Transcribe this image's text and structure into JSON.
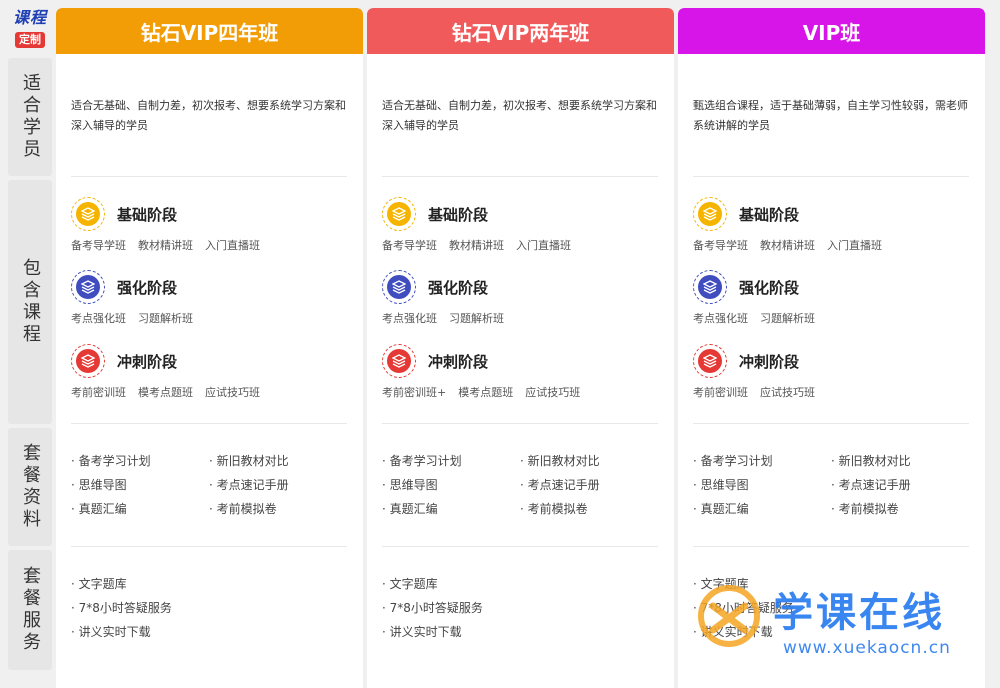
{
  "logo": {
    "top": "课程",
    "badge": "定制"
  },
  "rail": {
    "suitable": "适合学员",
    "courses": "包含课程",
    "materials": "套餐资料",
    "services": "套餐服务"
  },
  "colors": {
    "col1": "#f29c06",
    "col2": "#f15a5a",
    "col3": "#d815e8",
    "basic": "#f5b400",
    "strengthen": "#3f4dbf",
    "sprint": "#e53935"
  },
  "icons": {
    "stage": "layers-icon",
    "watermark": "xuekao-logo-icon"
  },
  "columns": [
    {
      "title": "钻石VIP四年班",
      "desc": "适合无基础、自制力差，初次报考、想要系统学习方案和深入辅导的学员",
      "stages": [
        {
          "title": "基础阶段",
          "items": [
            "备考导学班",
            "教材精讲班",
            "入门直播班"
          ]
        },
        {
          "title": "强化阶段",
          "items": [
            "考点强化班",
            "习题解析班"
          ]
        },
        {
          "title": "冲刺阶段",
          "items": [
            "考前密训班",
            "模考点题班",
            "应试技巧班"
          ]
        }
      ],
      "materials": [
        "· 备考学习计划",
        "· 新旧教材对比",
        "· 思维导图",
        "· 考点速记手册",
        "· 真题汇编",
        "· 考前模拟卷"
      ],
      "services": [
        "· 文字题库",
        "· 7*8小时答疑服务",
        "· 讲义实时下载"
      ]
    },
    {
      "title": "钻石VIP两年班",
      "desc": "适合无基础、自制力差，初次报考、想要系统学习方案和深入辅导的学员",
      "stages": [
        {
          "title": "基础阶段",
          "items": [
            "备考导学班",
            "教材精讲班",
            "入门直播班"
          ]
        },
        {
          "title": "强化阶段",
          "items": [
            "考点强化班",
            "习题解析班"
          ]
        },
        {
          "title": "冲刺阶段",
          "items": [
            "考前密训班+",
            "模考点题班",
            "应试技巧班"
          ]
        }
      ],
      "materials": [
        "· 备考学习计划",
        "· 新旧教材对比",
        "· 思维导图",
        "· 考点速记手册",
        "· 真题汇编",
        "· 考前模拟卷"
      ],
      "services": [
        "· 文字题库",
        "· 7*8小时答疑服务",
        "· 讲义实时下载"
      ]
    },
    {
      "title": "VIP班",
      "desc": "甄选组合课程，适于基础薄弱，自主学习性较弱，需老师系统讲解的学员",
      "stages": [
        {
          "title": "基础阶段",
          "items": [
            "备考导学班",
            "教材精讲班",
            "入门直播班"
          ]
        },
        {
          "title": "强化阶段",
          "items": [
            "考点强化班",
            "习题解析班"
          ]
        },
        {
          "title": "冲刺阶段",
          "items": [
            "考前密训班",
            "应试技巧班"
          ]
        }
      ],
      "materials": [
        "· 备考学习计划",
        "· 新旧教材对比",
        "· 思维导图",
        "· 考点速记手册",
        "· 真题汇编",
        "· 考前模拟卷"
      ],
      "services": [
        "· 文字题库",
        "· 7*8小时答疑服务",
        "· 讲义实时下载"
      ]
    }
  ],
  "watermark": {
    "name": "学课在线",
    "url": "www.xuekaocn.cn"
  }
}
